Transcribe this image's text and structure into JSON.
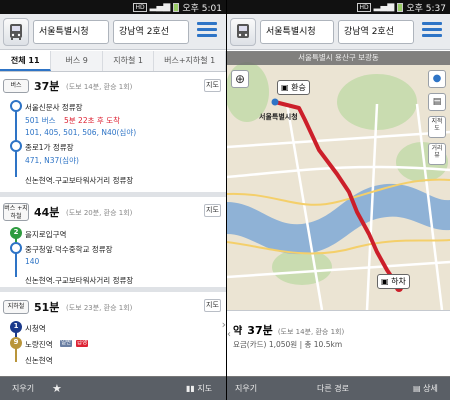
{
  "left": {
    "status": {
      "time": "오후 5:01"
    },
    "header": {
      "origin": "서울특별시청",
      "destination": "강남역 2호선"
    },
    "tabs": [
      {
        "label": "전체 11"
      },
      {
        "label": "버스 9"
      },
      {
        "label": "지하철 1"
      },
      {
        "label": "버스+지하철 1"
      }
    ],
    "routes": [
      {
        "tag": "버스",
        "time": "37분",
        "detail": "(도보 14분, 환승 1회)",
        "map_label": "지도",
        "s1": "서울신문사 정류장",
        "bus1": "501 버스",
        "arrival": "5분 22초 후 도착",
        "buses1": "101, 405, 501, 506, N40(심야)",
        "s2": "종로1가 정류장",
        "buses2": "471, N37(심야)",
        "s3": "신논현역.구교보타워사거리 정류장"
      },
      {
        "tag": "버스 +지하철",
        "time": "44분",
        "detail": "(도보 20분, 환승 1회)",
        "map_label": "지도",
        "line_num": "2",
        "s1": "을지로입구역",
        "s2": "중구청앞.덕수중학교 정류장",
        "buses": "140",
        "s3": "신논현역.구교보타워사거리 정류장"
      },
      {
        "tag": "지하철",
        "time": "51분",
        "detail": "(도보 23분, 환승 1회)",
        "map_label": "지도",
        "line1": "1",
        "s1": "시청역",
        "line2": "9",
        "s2": "노량진역",
        "badge1": "일반",
        "badge2": "급행",
        "s3": "신논현역"
      }
    ],
    "bottom": {
      "clear": "지우기",
      "star_icon": "★",
      "map": "지도"
    }
  },
  "right": {
    "status": {
      "time": "오후 5:37"
    },
    "header": {
      "origin": "서울특별시청",
      "destination": "강남역 2호선"
    },
    "map_title": "서울특별시 용산구 보광동",
    "controls": {
      "layer": "지적도",
      "street": "거리뷰"
    },
    "markers": {
      "transfer": "환승",
      "alight": "하차",
      "cityhall": "서울특별시청"
    },
    "summary": {
      "prefix": "약",
      "time": "37분",
      "detail": "(도보 14분, 환승 1회)",
      "fare": "요금(카드) 1,050원 | 총 10.5km"
    },
    "bottom": {
      "clear": "지우기",
      "other": "다른 경로",
      "detail": "상세"
    }
  },
  "colors": {
    "accent": "#2e74c6",
    "route_red": "#cc1f2a",
    "line1": "#1b3a8c",
    "line2": "#2e9b3f",
    "line9": "#b9953a"
  }
}
